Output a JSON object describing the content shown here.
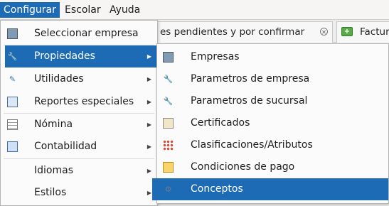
{
  "menubar": {
    "items": [
      {
        "label": "Configurar"
      },
      {
        "label": "Escolar"
      },
      {
        "label": "Ayuda"
      }
    ]
  },
  "tabs": [
    {
      "label": "es pendientes y por confirmar",
      "close": "✕"
    },
    {
      "label": "Factur"
    }
  ],
  "menu_main": {
    "items": [
      {
        "label": "Seleccionar empresa",
        "icon": "monitor-icon"
      },
      {
        "label": "Propiedades",
        "icon": "wrench-icon"
      },
      {
        "label": "Utilidades",
        "icon": "brush-icon"
      },
      {
        "label": "Reportes especiales",
        "icon": "documents-icon"
      },
      {
        "label": "Nómina",
        "icon": "table-icon"
      },
      {
        "label": "Contabilidad",
        "icon": "pen-doc-icon"
      },
      {
        "label": "Idiomas",
        "icon": ""
      },
      {
        "label": "Estilos",
        "icon": ""
      }
    ],
    "arrow": "▶"
  },
  "menu_sub": {
    "items": [
      {
        "label": "Empresas",
        "icon": "monitor-icon"
      },
      {
        "label": "Parametros de empresa",
        "icon": "wrench-icon"
      },
      {
        "label": "Parametros de sucursal",
        "icon": "wrench-icon"
      },
      {
        "label": "Certificados",
        "icon": "certificate-icon"
      },
      {
        "label": "Clasificaciones/Atributos",
        "icon": "grid-icon"
      },
      {
        "label": "Condiciones de pago",
        "icon": "calendar-clock-icon"
      },
      {
        "label": "Conceptos",
        "icon": "gear-doc-icon"
      }
    ]
  },
  "colors": {
    "highlight": "#1d6bb5",
    "menu_bg": "#fbfbfb"
  }
}
